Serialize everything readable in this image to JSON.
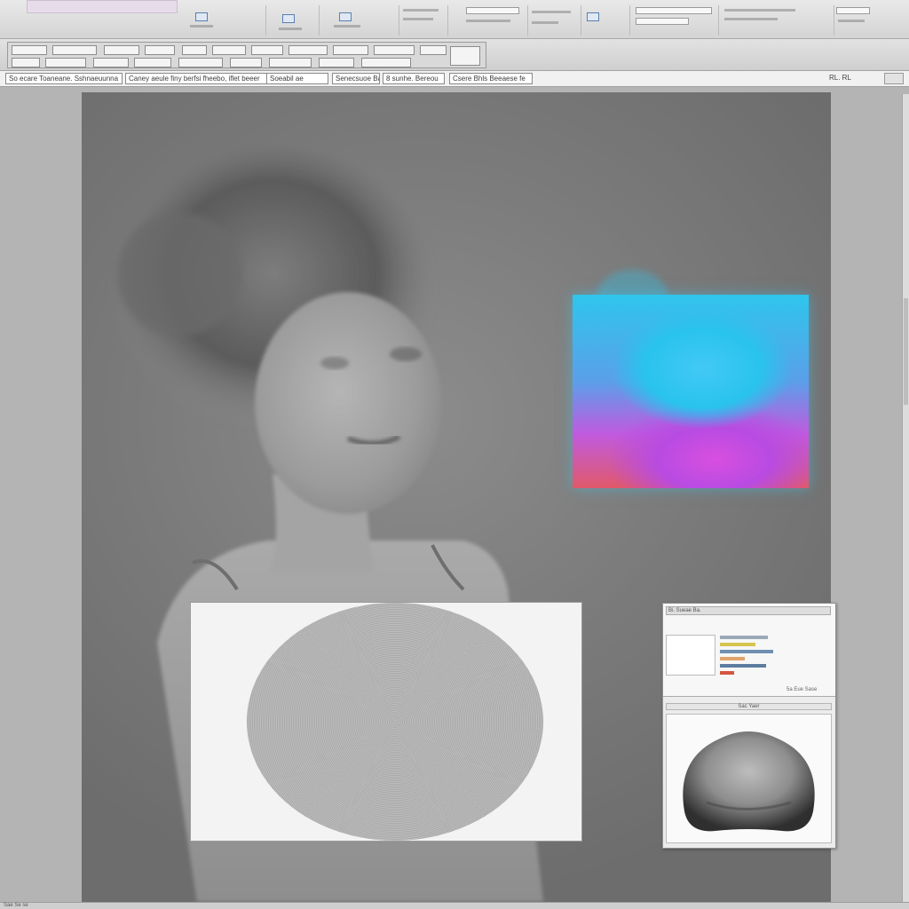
{
  "app": {
    "info_fields": [
      "So ecare Toaneane. Sshnaeuunna",
      "Caney aeule finy berfsi fheebo, iflet beeer",
      "Soeabil ae",
      "Senecsuoe Barasue",
      "8 sunhe. Bereou",
      "Csere Bhls Beeaese fe"
    ],
    "zoom_label": "RL. RL",
    "preview": {
      "title": "Bi. Sueae Ba.",
      "status": "5a Eue Sase",
      "sub_label": "Sac Yaer"
    },
    "bottom_status": "Sae Se se"
  },
  "colors": {
    "accent_cyan": "#29c3ee",
    "accent_magenta": "#c04fe0",
    "canvas_gray": "#7a7a7a"
  },
  "icons": [
    "ribbon-tool-icon",
    "toolbar-button-icon"
  ]
}
